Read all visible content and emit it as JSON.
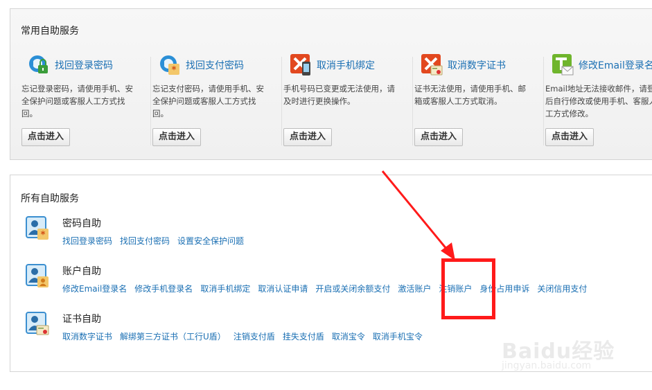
{
  "common_panel": {
    "title": "常用自助服务",
    "button_label": "点击进入",
    "cards": [
      {
        "title": "找回登录密码",
        "desc": "忘记登录密码，请使用手机、安全保护问题或客服人工方式找回。",
        "icon": "lock-recover-icon"
      },
      {
        "title": "找回支付密码",
        "desc": "忘记支付密码，请使用手机、安全保护问题或客服人工方式找回。",
        "icon": "pay-password-recover-icon"
      },
      {
        "title": "取消手机绑定",
        "desc": "手机号码已变更或无法使用，请及时进行更换操作。",
        "icon": "phone-unbind-icon"
      },
      {
        "title": "取消数字证书",
        "desc": "证书无法使用，请使用手机、邮箱或客服人工方式取消。",
        "icon": "certificate-cancel-icon"
      },
      {
        "title": "修改Email登录名",
        "desc": "Email地址无法接收邮件，请登录后自行修改或使用手机、客服人工方式修改。",
        "icon": "email-edit-icon"
      }
    ]
  },
  "all_panel": {
    "title": "所有自助服务",
    "groups": [
      {
        "title": "密码自助",
        "icon": "password-user-icon",
        "links": [
          "找回登录密码",
          "找回支付密码",
          "设置安全保护问题"
        ]
      },
      {
        "title": "账户自助",
        "icon": "account-user-icon",
        "links": [
          "修改Email登录名",
          "修改手机登录名",
          "取消手机绑定",
          "取消认证申请",
          "开启或关闭余额支付",
          "激活账户",
          "注销账户",
          "身份占用申诉",
          "关闭信用支付"
        ]
      },
      {
        "title": "证书自助",
        "icon": "certificate-user-icon",
        "links": [
          "取消数字证书",
          "解绑第三方证书（工行U盾）",
          "注销支付盾",
          "挂失支付盾",
          "取消宝令",
          "取消手机宝令"
        ]
      }
    ]
  },
  "watermark": {
    "logo": "Baidu经验",
    "url": "jingyan.baidu.com"
  },
  "colors": {
    "link": "#1a6fb3",
    "annotation": "#ff1a1a"
  }
}
